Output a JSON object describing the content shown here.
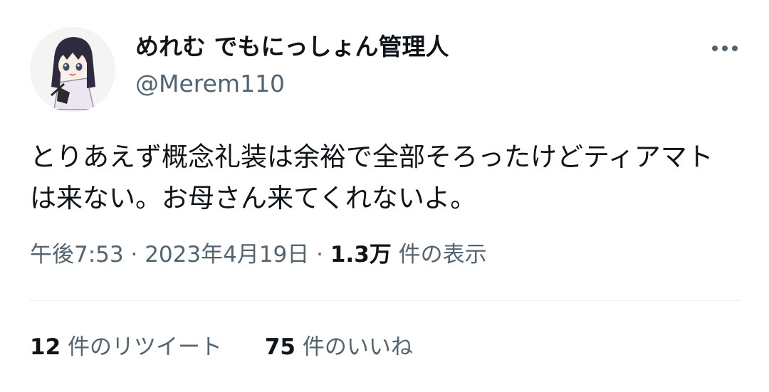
{
  "author": {
    "display_name": "めれむ でもにっしょん管理人",
    "handle": "@Merem110"
  },
  "tweet": {
    "text": "とりあえず概念礼装は余裕で全部そろったけどティアマトは来ない。お母さん来てくれないよ。"
  },
  "meta": {
    "time": "午後7:53",
    "date": "2023年4月19日",
    "separator": "·",
    "views_count": "1.3万",
    "views_label": "件の表示"
  },
  "stats": {
    "retweets_count": "12",
    "retweets_label": "件のリツイート",
    "likes_count": "75",
    "likes_label": "件のいいね"
  },
  "icons": {
    "more": "more-horizontal-icon",
    "avatar": "avatar-image"
  },
  "colors": {
    "text_primary": "#0f1419",
    "text_secondary": "#536471",
    "divider": "#eff3f4"
  }
}
